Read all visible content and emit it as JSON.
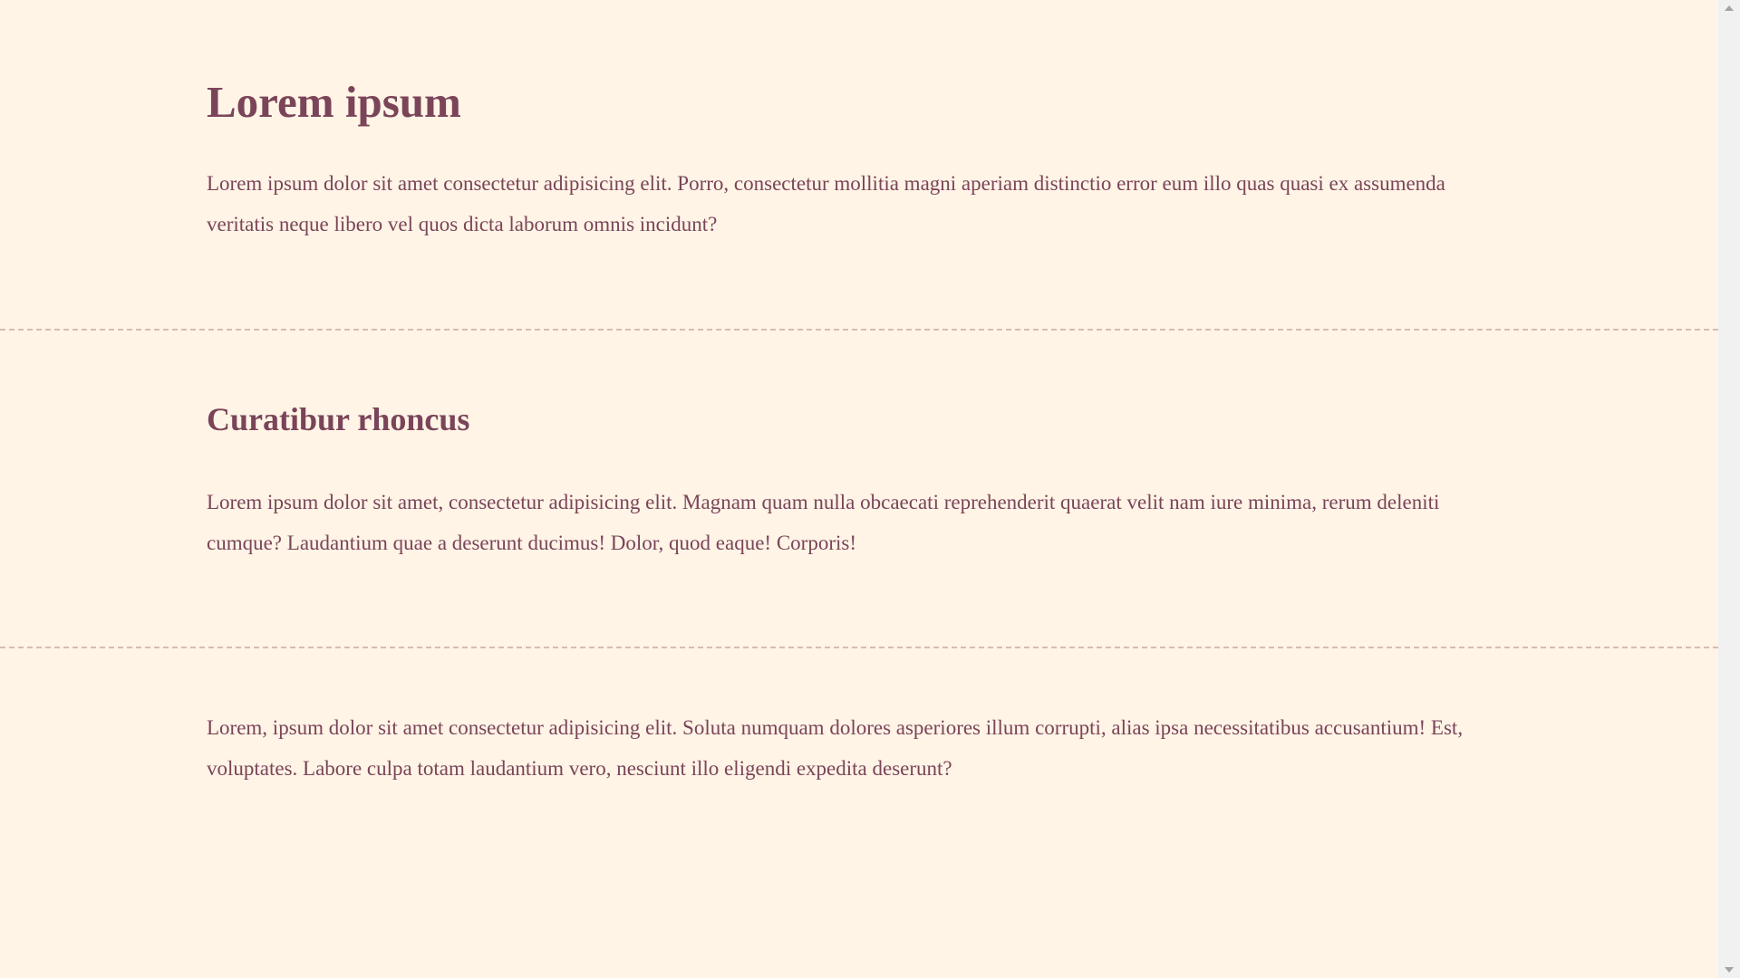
{
  "sections": [
    {
      "heading": "Lorem ipsum",
      "text": "Lorem ipsum dolor sit amet consectetur adipisicing elit. Porro, consectetur mollitia magni aperiam distinctio error eum illo quas quasi ex assumenda veritatis neque libero vel quos dicta laborum omnis incidunt?"
    },
    {
      "heading": "Curatibur rhoncus",
      "text": "Lorem ipsum dolor sit amet, consectetur adipisicing elit. Magnam quam nulla obcaecati reprehenderit quaerat velit nam iure minima, rerum deleniti cumque? Laudantium quae a deserunt ducimus! Dolor, quod eaque! Corporis!"
    },
    {
      "heading": "",
      "text": "Lorem, ipsum dolor sit amet consectetur adipisicing elit. Soluta numquam dolores asperiores illum corrupti, alias ipsa necessitatibus accusantium! Est, voluptates. Labore culpa totam laudantium vero, nesciunt illo eligendi expedita deserunt?"
    }
  ],
  "colors": {
    "background": "#fff4e6",
    "text": "#7a4459",
    "divider": "#d8bcb0"
  },
  "scrollbar": {
    "up_icon": "chevron-up-icon",
    "down_icon": "chevron-down-icon"
  }
}
